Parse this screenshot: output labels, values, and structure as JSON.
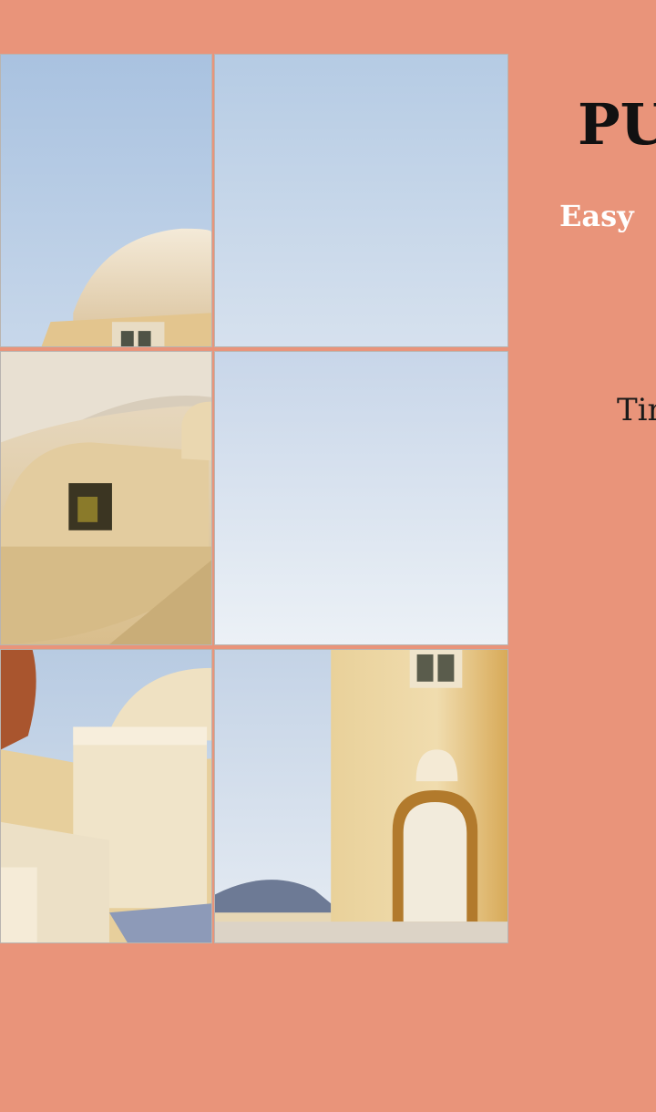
{
  "game": {
    "title": "PU",
    "difficulty": "Easy",
    "timer_label": "Tin"
  },
  "colors": {
    "background": "#e9947a",
    "title": "#111111",
    "difficulty": "#ffffff",
    "tile_border": "#b9b4b0"
  },
  "tiles": [
    {
      "name": "tile-dome-roof",
      "icon": "dome-roof-image"
    },
    {
      "name": "tile-sky",
      "icon": "sky-image"
    },
    {
      "name": "tile-rooftops-window",
      "icon": "rooftops-window-image"
    },
    {
      "name": "tile-sky-gradient",
      "icon": "sky-gradient-image"
    },
    {
      "name": "tile-vase-rooftops",
      "icon": "vase-rooftops-image"
    },
    {
      "name": "tile-tower-door",
      "icon": "tower-door-image"
    }
  ]
}
